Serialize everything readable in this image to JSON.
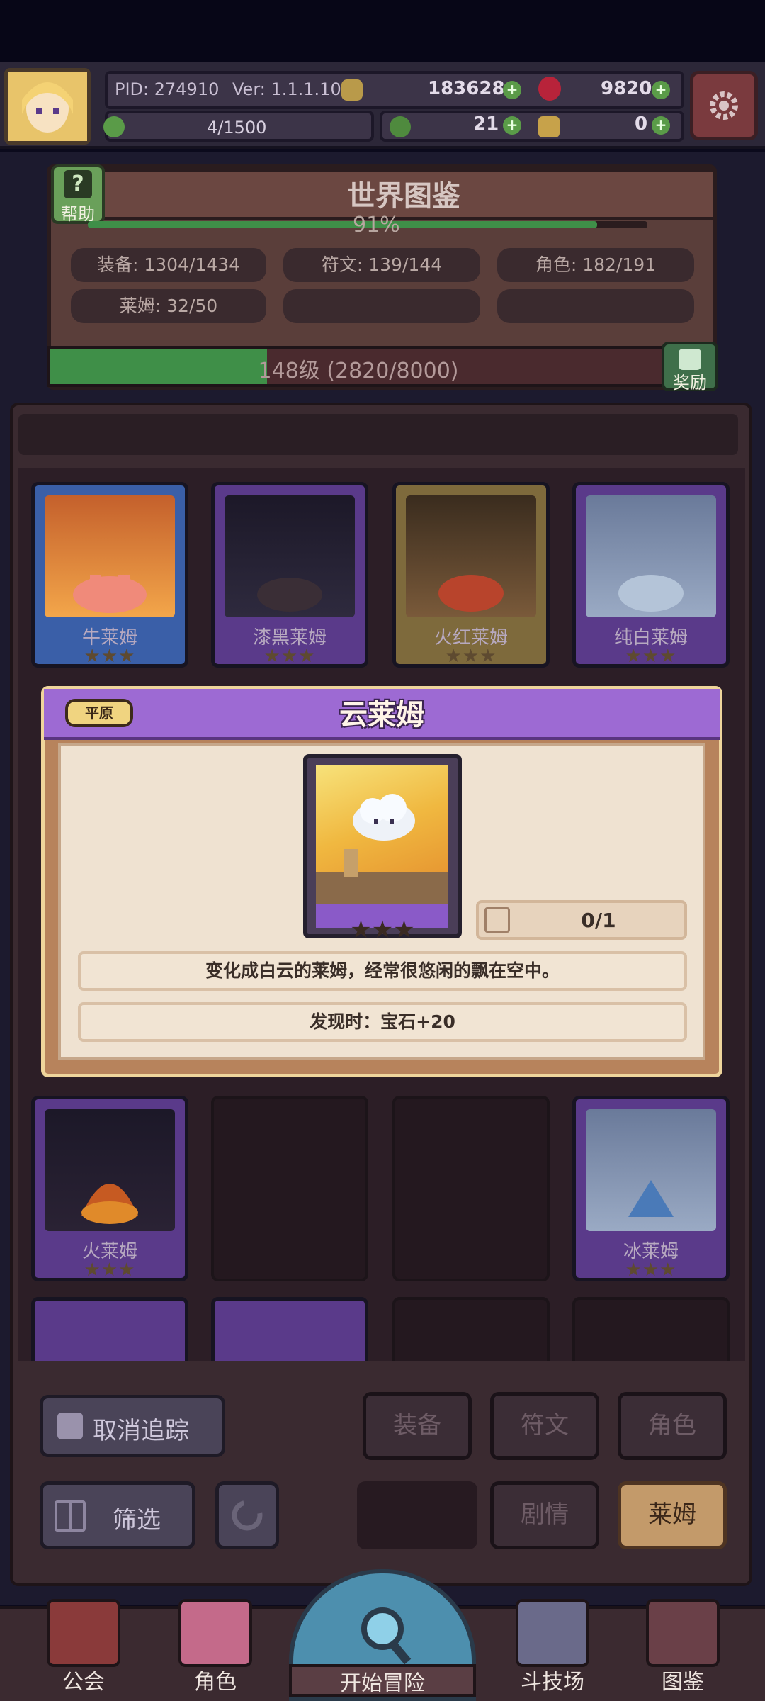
{
  "header": {
    "pid": "PID: 274910",
    "version": "Ver: 1.1.1.10",
    "gold": "183628",
    "gems": "9820",
    "stamina": "4/1500",
    "clover": "21",
    "key": "0"
  },
  "encyclopedia": {
    "title": "世界图鉴",
    "help_label": "帮助",
    "percent": "91%",
    "stats": {
      "equipment": "装备: 1304/1434",
      "rune": "符文: 139/144",
      "character": "角色: 182/191",
      "slime": "莱姆: 32/50"
    },
    "level": "148级 (2820/8000)",
    "level_progress": 0.3525,
    "reward_label": "奖励"
  },
  "cards_row1": [
    {
      "name": "牛莱姆",
      "stars": "★★★",
      "frame": "blue"
    },
    {
      "name": "漆黑莱姆",
      "stars": "★★★",
      "frame": "purple"
    },
    {
      "name": "火红莱姆",
      "stars": "★★★",
      "frame": "gold"
    },
    {
      "name": "纯白莱姆",
      "stars": "★★★",
      "frame": "purple"
    }
  ],
  "cards_row3": [
    {
      "name": "火莱姆",
      "stars": "★★★",
      "frame": "purple"
    },
    {
      "name": "冰莱姆",
      "stars": "★★★",
      "frame": "purple"
    }
  ],
  "dialog": {
    "region": "平原",
    "title": "云莱姆",
    "stars": "★★★",
    "count": "0/1",
    "description": "变化成白云的莱姆，经常很悠闲的飘在空中。",
    "discovery": "发现时：宝石+20"
  },
  "controls": {
    "untrack": "取消追踪",
    "equipment": "装备",
    "rune": "符文",
    "character": "角色",
    "filter": "筛选",
    "story": "剧情",
    "slime": "莱姆"
  },
  "nav": {
    "guild": "公会",
    "character": "角色",
    "adventure": "开始冒险",
    "arena": "斗技场",
    "codex": "图鉴"
  },
  "colors": {
    "accent_purple": "#9d6ad3",
    "progress_green": "#3f8f48",
    "dialog_cream": "#efe2d1"
  }
}
